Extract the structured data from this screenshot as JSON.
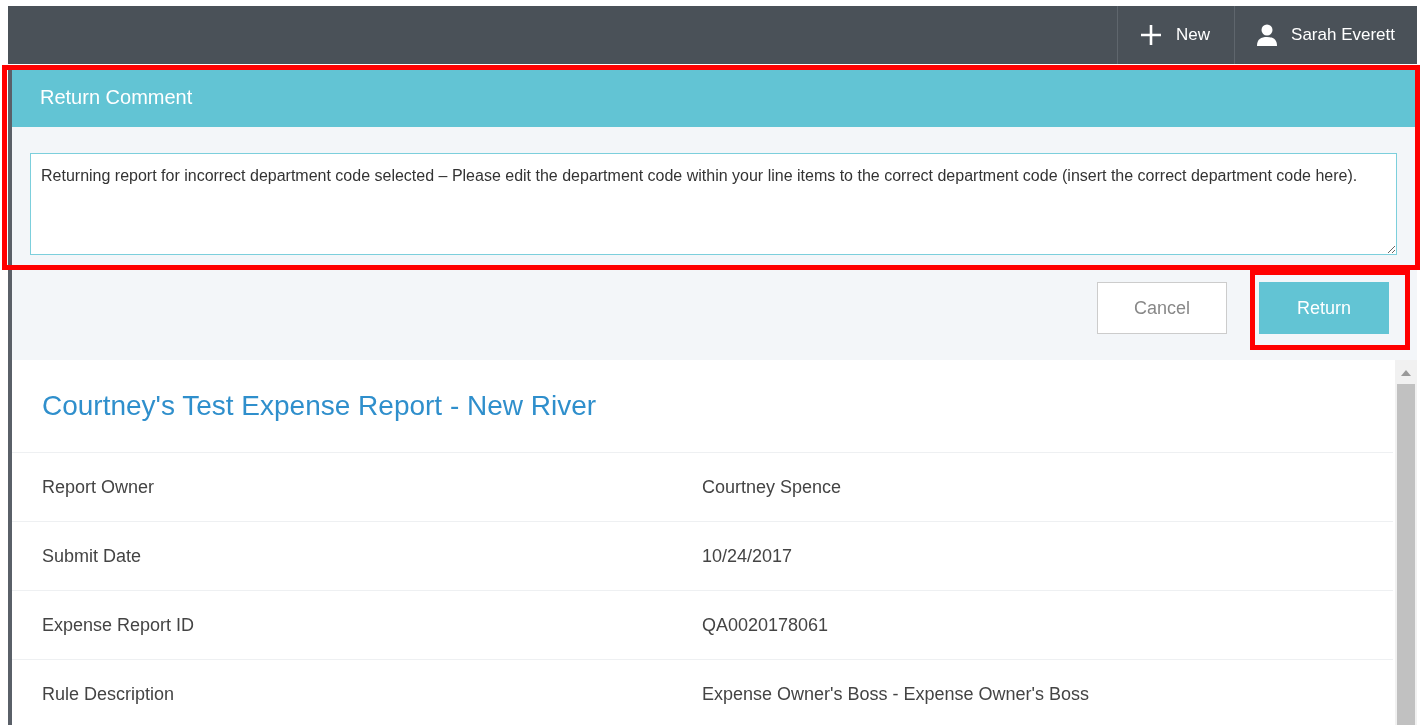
{
  "top_bar": {
    "new_label": "New",
    "user_name": "Sarah Everett"
  },
  "dialog": {
    "title": "Return Comment",
    "comment": "Returning report for incorrect department code selected – Please edit the department code within your line items to the correct department code (insert the correct department code here).",
    "buttons": [
      {
        "label": "Cancel",
        "kind": "secondary"
      },
      {
        "label": "Return",
        "kind": "primary"
      }
    ]
  },
  "report": {
    "title": "Courtney's Test Expense Report - New River",
    "fields": [
      {
        "label": "Report Owner",
        "value": "Courtney Spence"
      },
      {
        "label": "Submit Date",
        "value": "10/24/2017"
      },
      {
        "label": "Expense Report ID",
        "value": "QA0020178061"
      },
      {
        "label": "Rule Description",
        "value": "Expense Owner's Boss - Expense Owner's Boss"
      }
    ]
  }
}
